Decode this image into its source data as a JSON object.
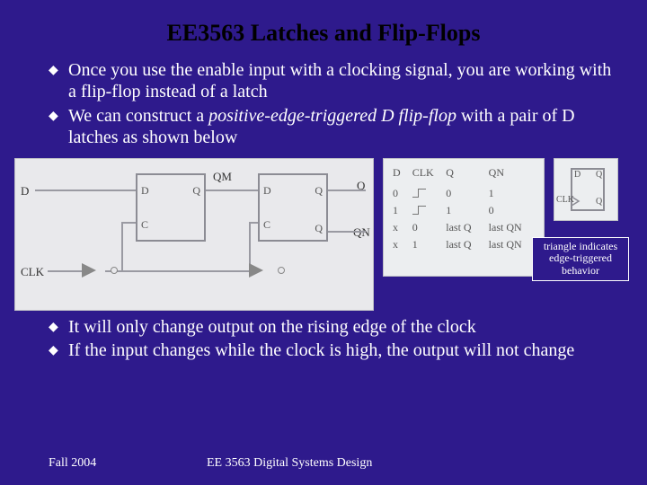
{
  "title": "EE3563 Latches and Flip-Flops",
  "bullets_top": [
    "Once you use the enable input with a clocking signal, you are working with a flip-flop instead of a latch",
    "We can construct a positive-edge-triggered D flip-flop with a pair of D latches as shown below"
  ],
  "bullets_top_italic": "positive-edge-triggered D flip-flop",
  "circuit": {
    "d_label": "D",
    "clk_label": "CLK",
    "qm_label": "QM",
    "q_label": "Q",
    "qn_label": "QN",
    "latch_pin_d": "D",
    "latch_pin_c": "C",
    "latch_pin_q": "Q"
  },
  "truth_table": {
    "headers": [
      "D",
      "CLK",
      "Q",
      "QN"
    ],
    "rows": [
      [
        "0",
        "edge",
        "0",
        "1"
      ],
      [
        "1",
        "edge",
        "1",
        "0"
      ],
      [
        "x",
        "0",
        "last Q",
        "last QN"
      ],
      [
        "x",
        "1",
        "last Q",
        "last QN"
      ]
    ]
  },
  "symbol": {
    "d": "D",
    "clk": "CLK",
    "q": "Q",
    "qn": "Q"
  },
  "callout": "triangle indicates edge-triggered behavior",
  "bullets_bottom": [
    "It will only change output on the rising edge of the clock",
    "If the input changes while the clock is high, the output will not change"
  ],
  "footer": {
    "left": "Fall 2004",
    "mid": "EE 3563 Digital Systems Design"
  }
}
